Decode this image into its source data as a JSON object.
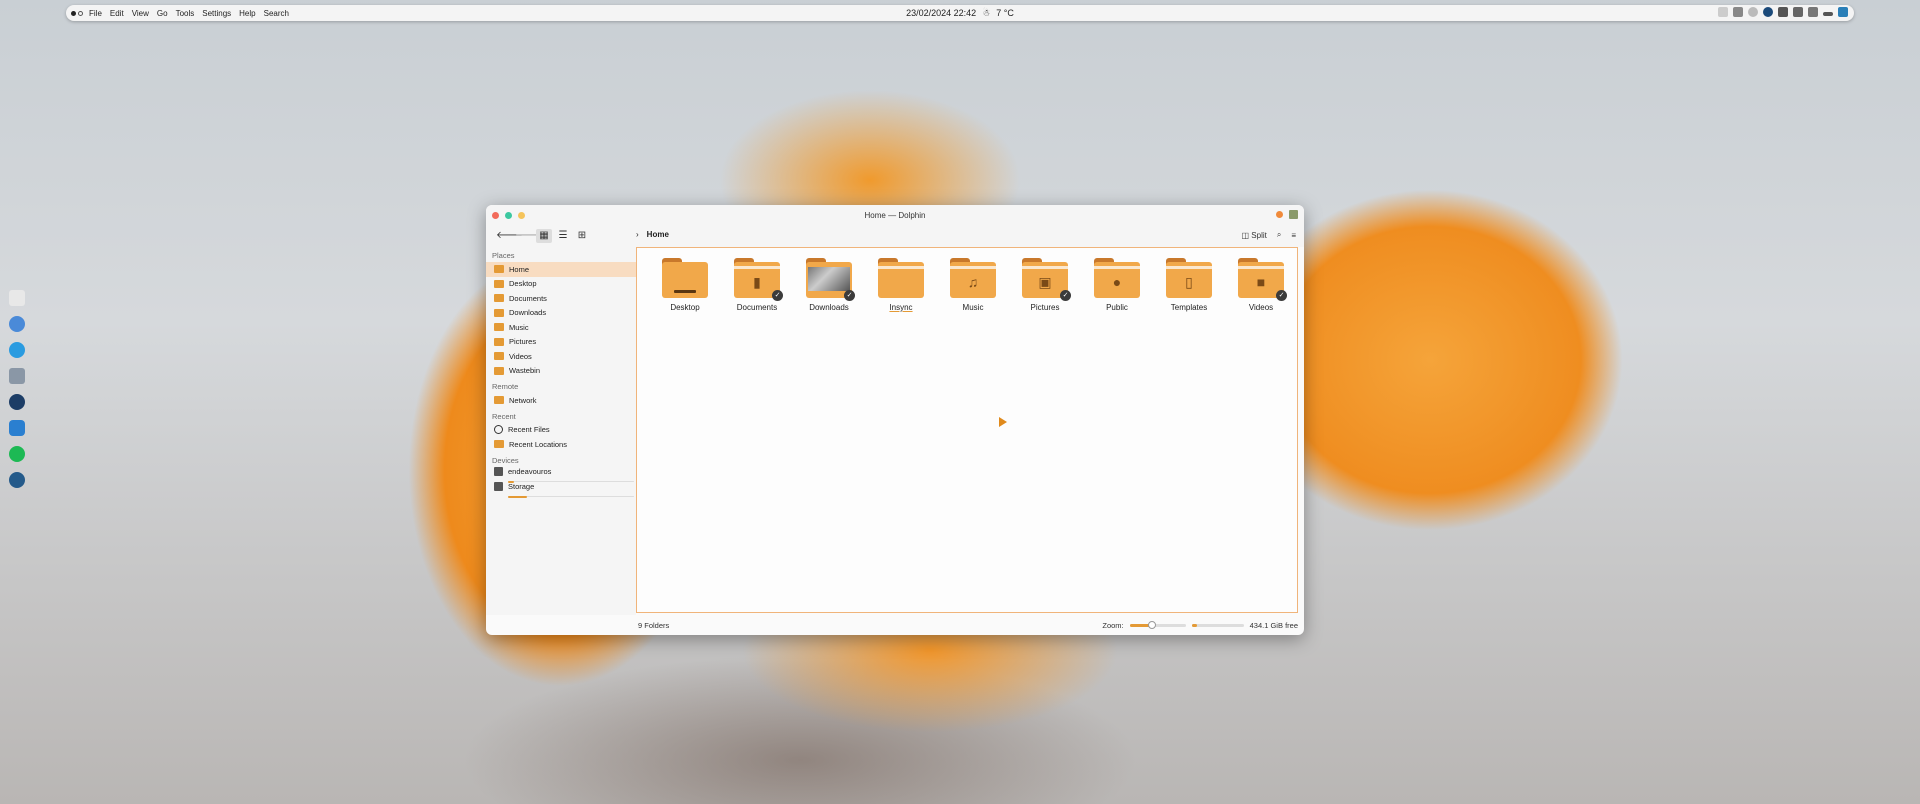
{
  "colors": {
    "accent": "#e49a35",
    "selection": "#f8dcc1"
  },
  "topbar": {
    "menu": [
      "File",
      "Edit",
      "View",
      "Go",
      "Tools",
      "Settings",
      "Help",
      "Search"
    ],
    "datetime": "23/02/2024  22:42",
    "weather_icon": "weather-snow-icon",
    "temperature": "7 °C"
  },
  "window": {
    "title": "Home — Dolphin",
    "breadcrumb": "Home",
    "split_label": "Split"
  },
  "sidebar": {
    "places_header": "Places",
    "places": [
      {
        "label": "Home",
        "active": true
      },
      {
        "label": "Desktop"
      },
      {
        "label": "Documents"
      },
      {
        "label": "Downloads"
      },
      {
        "label": "Music"
      },
      {
        "label": "Pictures"
      },
      {
        "label": "Videos"
      },
      {
        "label": "Wastebin"
      }
    ],
    "remote_header": "Remote",
    "remote": [
      {
        "label": "Network"
      }
    ],
    "recent_header": "Recent",
    "recent": [
      {
        "label": "Recent Files"
      },
      {
        "label": "Recent Locations"
      }
    ],
    "devices_header": "Devices",
    "devices": [
      {
        "label": "endeavouros",
        "usage": 0.05
      },
      {
        "label": "Storage",
        "usage": 0.15
      }
    ]
  },
  "folders": [
    {
      "label": "Desktop",
      "icon": "desktop-folder-icon"
    },
    {
      "label": "Documents",
      "icon": "documents-folder-icon",
      "badge": true
    },
    {
      "label": "Downloads",
      "icon": "downloads-folder-icon",
      "badge": true
    },
    {
      "label": "Insync",
      "icon": "folder-icon"
    },
    {
      "label": "Music",
      "icon": "music-folder-icon"
    },
    {
      "label": "Pictures",
      "icon": "pictures-folder-icon",
      "badge": true
    },
    {
      "label": "Public",
      "icon": "public-folder-icon"
    },
    {
      "label": "Templates",
      "icon": "templates-folder-icon"
    },
    {
      "label": "Videos",
      "icon": "videos-folder-icon",
      "badge": true
    }
  ],
  "status": {
    "count": "9 Folders",
    "zoom_label": "Zoom:",
    "zoom_level": 0.4,
    "free_space": "434.1 GiB free",
    "used_fraction": 0.1
  }
}
